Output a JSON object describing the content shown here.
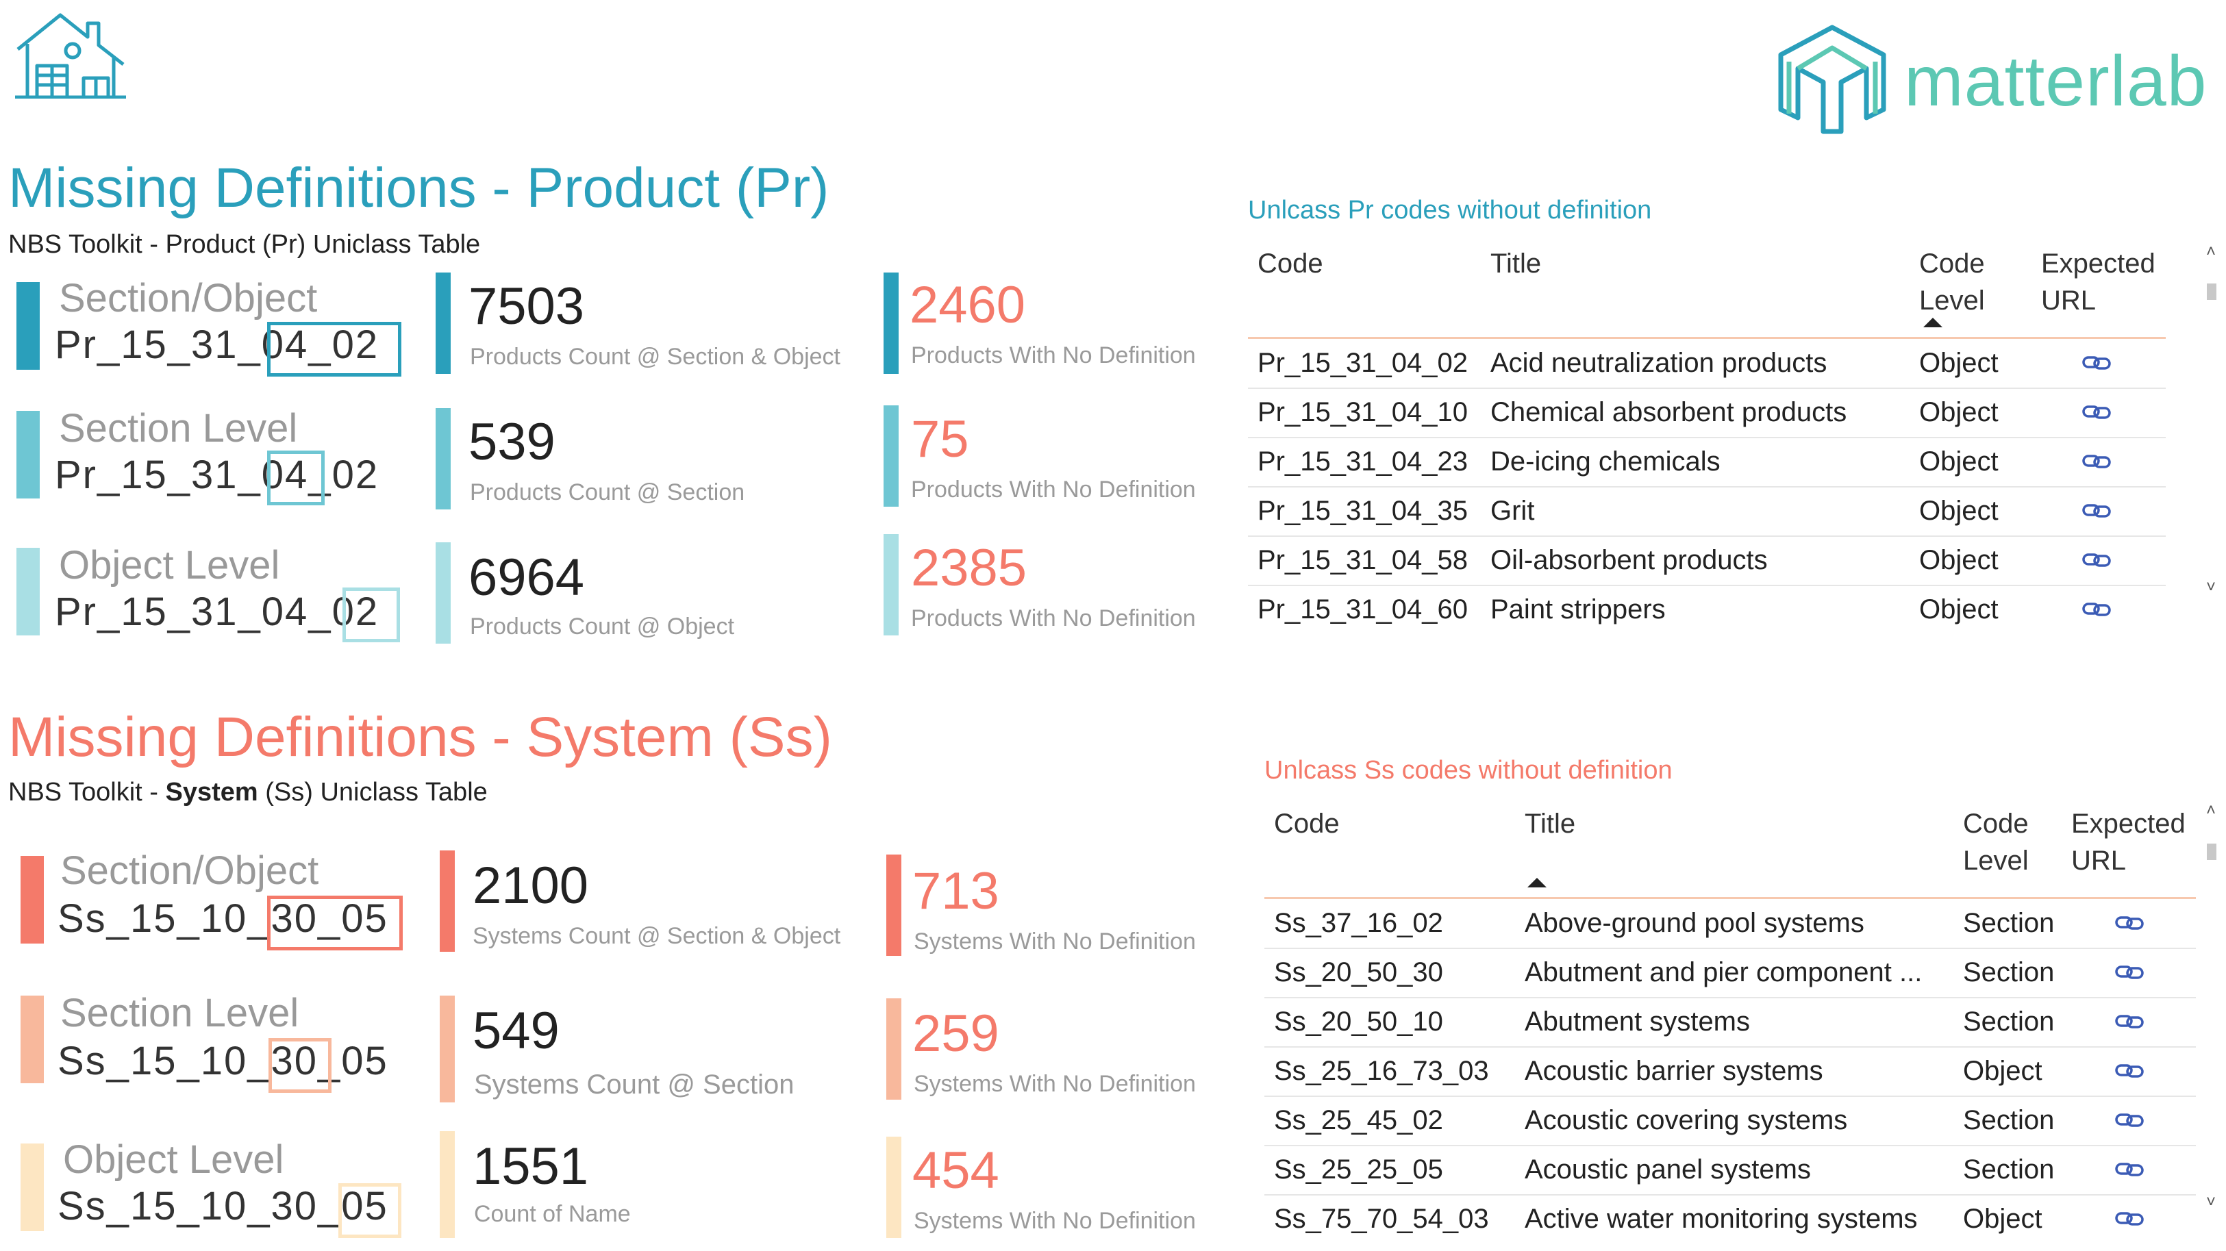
{
  "colors": {
    "teal": "#2a9fbb",
    "teal_mid": "#6ec6d3",
    "teal_light": "#a9dfe4",
    "salmon": "#f47a6a",
    "salmon_mid": "#f8b89c",
    "salmon_light": "#fde6c2",
    "logo_green": "#5cc8b3"
  },
  "header": {
    "house_icon": "house-icon",
    "logo_text": "matterlab"
  },
  "product": {
    "title": "Missing Definitions - Product (Pr)",
    "subtitle": "NBS Toolkit - Product (Pr) Uniclass Table",
    "cards": [
      {
        "label": "Section/Object",
        "code": "Pr_15_31_04_02"
      },
      {
        "label": "Section Level",
        "code": "Pr_15_31_04_02"
      },
      {
        "label": "Object Level",
        "code": "Pr_15_31_04_02"
      }
    ],
    "counts": [
      {
        "value": "7503",
        "label": "Products Count @ Section & Object"
      },
      {
        "value": "539",
        "label": "Products Count @ Section"
      },
      {
        "value": "6964",
        "label": "Products Count @ Object"
      }
    ],
    "missing": [
      {
        "value": "2460",
        "label": "Products With No Definition"
      },
      {
        "value": "75",
        "label": "Products With No Definition"
      },
      {
        "value": "2385",
        "label": "Products With No Definition"
      }
    ],
    "table": {
      "title": "Unlcass Pr codes without definition",
      "columns": [
        "Code",
        "Title",
        "Code Level",
        "Expected URL"
      ],
      "sorted_by": "Code Level",
      "rows": [
        {
          "code": "Pr_15_31_04_02",
          "title": "Acid neutralization products",
          "level": "Object",
          "url": "link-icon"
        },
        {
          "code": "Pr_15_31_04_10",
          "title": "Chemical absorbent products",
          "level": "Object",
          "url": "link-icon"
        },
        {
          "code": "Pr_15_31_04_23",
          "title": "De-icing chemicals",
          "level": "Object",
          "url": "link-icon"
        },
        {
          "code": "Pr_15_31_04_35",
          "title": "Grit",
          "level": "Object",
          "url": "link-icon"
        },
        {
          "code": "Pr_15_31_04_58",
          "title": "Oil-absorbent products",
          "level": "Object",
          "url": "link-icon"
        },
        {
          "code": "Pr_15_31_04_60",
          "title": "Paint strippers",
          "level": "Object",
          "url": "link-icon"
        }
      ]
    }
  },
  "system": {
    "title": "Missing Definitions - System (Ss)",
    "subtitle_pre": "NBS Toolkit - ",
    "subtitle_bold": "System",
    "subtitle_post": " (Ss) Uniclass Table",
    "cards": [
      {
        "label": "Section/Object",
        "code": "Ss_15_10_30_05"
      },
      {
        "label": "Section Level",
        "code": "Ss_15_10_30_05"
      },
      {
        "label": "Object Level",
        "code": "Ss_15_10_30_05"
      }
    ],
    "counts": [
      {
        "value": "2100",
        "label": "Systems Count @ Section & Object"
      },
      {
        "value": "549",
        "label": "Systems Count @ Section"
      },
      {
        "value": "1551",
        "label": "Count of Name"
      }
    ],
    "missing": [
      {
        "value": "713",
        "label": "Systems With No Definition"
      },
      {
        "value": "259",
        "label": "Systems With No Definition"
      },
      {
        "value": "454",
        "label": "Systems With No Definition"
      }
    ],
    "table": {
      "title": "Unlcass Ss codes without definition",
      "columns": [
        "Code",
        "Title",
        "Code Level",
        "Expected URL"
      ],
      "sorted_by": "Title",
      "rows": [
        {
          "code": "Ss_37_16_02",
          "title": "Above-ground pool systems",
          "level": "Section",
          "url": "link-icon"
        },
        {
          "code": "Ss_20_50_30",
          "title": "Abutment and pier component ...",
          "level": "Section",
          "url": "link-icon"
        },
        {
          "code": "Ss_20_50_10",
          "title": "Abutment systems",
          "level": "Section",
          "url": "link-icon"
        },
        {
          "code": "Ss_25_16_73_03",
          "title": "Acoustic barrier systems",
          "level": "Object",
          "url": "link-icon"
        },
        {
          "code": "Ss_25_45_02",
          "title": "Acoustic covering systems",
          "level": "Section",
          "url": "link-icon"
        },
        {
          "code": "Ss_25_25_05",
          "title": "Acoustic panel systems",
          "level": "Section",
          "url": "link-icon"
        },
        {
          "code": "Ss_75_70_54_03",
          "title": "Active water monitoring systems",
          "level": "Object",
          "url": "link-icon"
        }
      ]
    }
  }
}
